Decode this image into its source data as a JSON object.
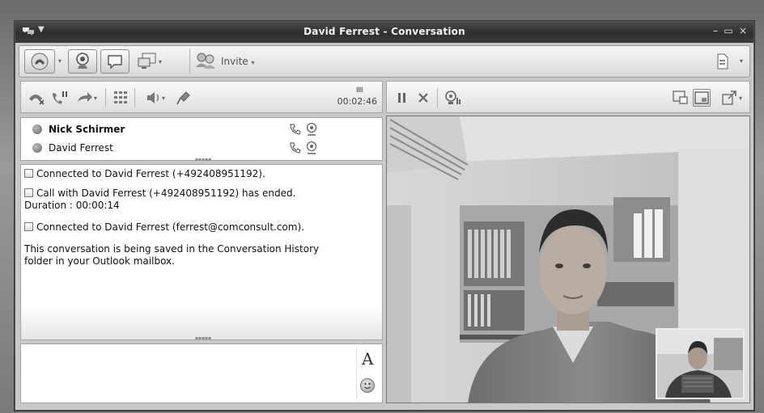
{
  "window": {
    "title": "David Ferrest - Conversation",
    "app_menu": "▼",
    "minimize": "–",
    "maximize": "▭",
    "close": "×"
  },
  "toolbar": {
    "invite_label": "Invite",
    "caret": "▾"
  },
  "call_controls": {
    "timer": "00:02:46",
    "signal": "IIIII"
  },
  "participants": [
    {
      "name": "Nick Schirmer",
      "bold": true
    },
    {
      "name": "David Ferrest",
      "bold": false
    }
  ],
  "history": {
    "messages": [
      "Connected to David Ferrest (+492408951192).",
      "Call with David Ferrest (+492408951192) has ended.",
      "Duration : 00:00:14",
      "Connected to David Ferrest (ferrest@comconsult.com).",
      "This conversation is being saved in the Conversation History",
      "folder in your Outlook mailbox."
    ]
  },
  "input": {
    "font_label": "A"
  },
  "grip": "▪▪▪▪▪",
  "icons": {
    "app": "chat-bubbles-icon",
    "call": "phone-icon",
    "video": "webcam-icon",
    "im": "speech-bubble-icon",
    "share": "desktop-share-icon",
    "invite": "add-contact-icon",
    "options": "document-icon",
    "end_call": "hang-up-icon",
    "hold": "hold-icon",
    "transfer": "transfer-arrow-icon",
    "dialpad": "dialpad-icon",
    "volume": "speaker-icon",
    "mic": "microphone-icon",
    "pause_video": "pause-icon",
    "stop_video": "stop-x-icon",
    "camera_settings": "camera-settings-icon",
    "view_pip": "picture-in-picture-icon",
    "view_full": "full-view-icon",
    "popout": "popout-icon"
  }
}
